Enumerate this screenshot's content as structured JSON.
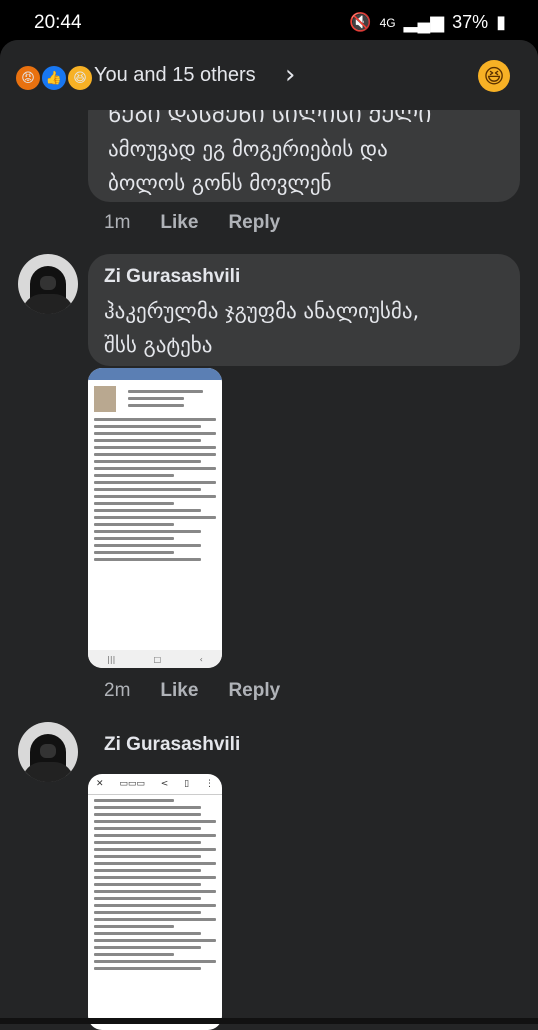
{
  "status_bar": {
    "time": "20:44",
    "network": "4G",
    "battery": "37%"
  },
  "header": {
    "reactions_label": "You and 15 others",
    "chevron": "›",
    "reaction_icons": [
      "angry-icon",
      "like-icon",
      "haha-icon"
    ]
  },
  "comments": [
    {
      "text_partial_top": "ᲬᲔᲑᲘ ᲓᲐᲡᲛᲔᲜᲘ ᲡᲘᲚᲘᲡᲘ ᲥᲔᲚᲘ",
      "text": "ამოუვად ეგ მოგერიების და\nბოლოს გონს მოვლენ",
      "time": "1m",
      "like": "Like",
      "reply": "Reply"
    },
    {
      "author": "Zi Gurasashvili",
      "text": "ჰაკერულმა ჯგუფმა ანალიუსმა,\nშსს გატეხა",
      "time": "2m",
      "like": "Like",
      "reply": "Reply"
    },
    {
      "author": "Zi Gurasashvili"
    }
  ],
  "colors": {
    "bubble": "#3a3b3c",
    "sheet": "#242526",
    "text": "#e4e6eb",
    "muted": "#b0b3b8"
  }
}
